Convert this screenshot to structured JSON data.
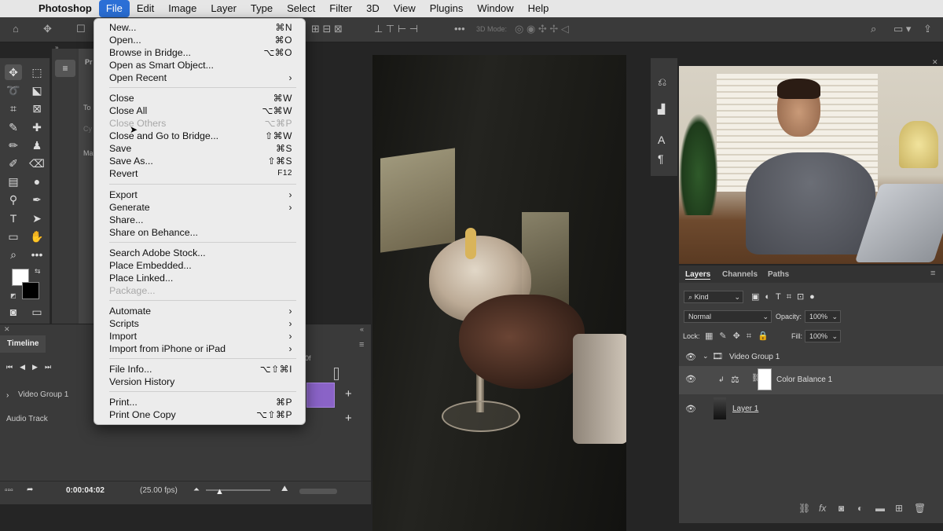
{
  "menubar": {
    "app": "Photoshop",
    "items": [
      "File",
      "Edit",
      "Image",
      "Layer",
      "Type",
      "Select",
      "Filter",
      "3D",
      "View",
      "Plugins",
      "Window",
      "Help"
    ]
  },
  "options": {
    "three_d_mode": "3D Mode:"
  },
  "file_menu": {
    "new": {
      "label": "New...",
      "shortcut": "⌘N"
    },
    "open": {
      "label": "Open...",
      "shortcut": "⌘O"
    },
    "browse_bridge": {
      "label": "Browse in Bridge...",
      "shortcut": "⌥⌘O"
    },
    "open_smart": {
      "label": "Open as Smart Object...",
      "shortcut": ""
    },
    "open_recent": {
      "label": "Open Recent",
      "shortcut": "›"
    },
    "close": {
      "label": "Close",
      "shortcut": "⌘W"
    },
    "close_all": {
      "label": "Close All",
      "shortcut": "⌥⌘W"
    },
    "close_others": {
      "label": "Close Others",
      "shortcut": "⌥⌘P"
    },
    "close_bridge": {
      "label": "Close and Go to Bridge...",
      "shortcut": "⇧⌘W"
    },
    "save": {
      "label": "Save",
      "shortcut": "⌘S"
    },
    "save_as": {
      "label": "Save As...",
      "shortcut": "⇧⌘S"
    },
    "revert": {
      "label": "Revert",
      "shortcut": "F12"
    },
    "export": {
      "label": "Export",
      "shortcut": "›"
    },
    "generate": {
      "label": "Generate",
      "shortcut": "›"
    },
    "share": {
      "label": "Share...",
      "shortcut": ""
    },
    "share_behance": {
      "label": "Share on Behance...",
      "shortcut": ""
    },
    "search_stock": {
      "label": "Search Adobe Stock...",
      "shortcut": ""
    },
    "place_embedded": {
      "label": "Place Embedded...",
      "shortcut": ""
    },
    "place_linked": {
      "label": "Place Linked...",
      "shortcut": ""
    },
    "package": {
      "label": "Package...",
      "shortcut": ""
    },
    "automate": {
      "label": "Automate",
      "shortcut": "›"
    },
    "scripts": {
      "label": "Scripts",
      "shortcut": "›"
    },
    "import": {
      "label": "Import",
      "shortcut": "›"
    },
    "import_iphone": {
      "label": "Import from iPhone or iPad",
      "shortcut": "›"
    },
    "file_info": {
      "label": "File Info...",
      "shortcut": "⌥⇧⌘I"
    },
    "version_history": {
      "label": "Version History",
      "shortcut": ""
    },
    "print": {
      "label": "Print...",
      "shortcut": "⌘P"
    },
    "print_one": {
      "label": "Print One Copy",
      "shortcut": "⌥⇧⌘P"
    }
  },
  "timeline": {
    "tab": "Timeline",
    "video_group": "Video Group 1",
    "audio_track": "Audio Track",
    "timecode": "0:00:04:02",
    "fps": "(25.00 fps)",
    "marker": "0f"
  },
  "props_fragments": {
    "pr": "Pr",
    "to": "To",
    "cy": "Cy",
    "ma": "Ma"
  },
  "layers_panel": {
    "tabs": [
      "Layers",
      "Channels",
      "Paths"
    ],
    "filter_kind": "Kind",
    "blend_mode": "Normal",
    "opacity_label": "Opacity:",
    "opacity": "100%",
    "lock_label": "Lock:",
    "fill_label": "Fill:",
    "fill": "100%",
    "layers": [
      {
        "name": "Video Group 1"
      },
      {
        "name": "Color Balance 1"
      },
      {
        "name": "Layer 1"
      }
    ]
  },
  "colors": {
    "accent": "#2b6fd6",
    "clip": "#8a63c7"
  }
}
